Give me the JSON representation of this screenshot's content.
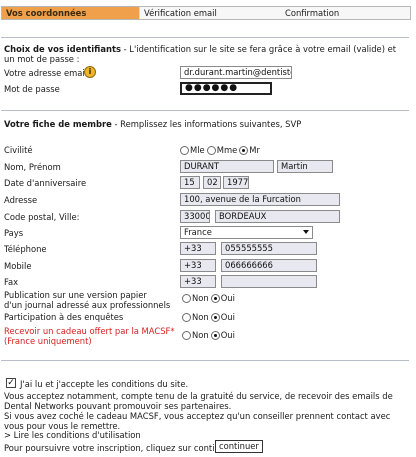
{
  "steps": [
    {
      "label": "Vos coordonnées"
    },
    {
      "label": "Vérification email"
    },
    {
      "label": "Confirmation"
    }
  ],
  "ident": {
    "title": "Choix de vos identifiants",
    "subtitle": " - L'identification sur le site se fera grâce à votre email (valide) et un mot de passe :",
    "email_label": "Votre adresse email",
    "email_value": "dr.durant.martin@dentiste.fr",
    "password_label": "Mot de passe",
    "password_value": "●●●●●●"
  },
  "member": {
    "title": "Votre fiche de membre",
    "subtitle": " - Remplissez les informations suivantes, SVP",
    "civilite_label": "Civilité",
    "civilite_options": [
      "Mle",
      "Mme",
      "Mr"
    ],
    "civilite_selected": "Mr",
    "name_label": "Nom, Prénom",
    "last_name": "DURANT",
    "first_name": "Martin",
    "birth_label": "Date d'anniversaire",
    "birth_day": "15",
    "birth_month": "02",
    "birth_year": "1977",
    "address_label": "Adresse",
    "address_value": "100, avenue de la Furcation",
    "postal_label": "Code postal, Ville:",
    "postal_value": "33000",
    "city_value": "BORDEAUX",
    "country_label": "Pays",
    "country_value": "France",
    "phone_label": "Téléphone",
    "phone_prefix": "+33",
    "phone_value": "055555555",
    "mobile_label": "Mobile",
    "mobile_prefix": "+33",
    "mobile_value": "066666666",
    "fax_label": "Fax",
    "fax_prefix": "+33",
    "fax_value": "",
    "journal_label_1": "Publication sur une version papier",
    "journal_label_2": "d'un journal adressé aux professionnels",
    "surveys_label": "Participation à des enquêtes",
    "gift_label_1": "Recevoir un cadeau offert par la MACSF*",
    "gift_label_2": "(France uniquement)",
    "no_label": "Non",
    "yes_label": "Oui"
  },
  "footer": {
    "accept_label": "J'ai lu et j'accepte les conditions du site.",
    "para1": "Vous acceptez notamment, compte tenu de la gratuité du service, de recevoir des emails de Dental Networks pouvant promouvoir ses partenaires.",
    "para2": "Si vous avez coché le cadeau MACSF, vous acceptez qu'un conseiller prennent contact avec vous pour vous le remettre.",
    "read_link": "> Lire les conditions d'utilisation",
    "continue_text": "Pour poursuivre votre inscription, cliquez sur continuer",
    "continue_button": "continuer"
  },
  "colors": {
    "active_step": "#f0a04b",
    "field_bg": "#e8e8f0",
    "required_text": "#d82020"
  }
}
